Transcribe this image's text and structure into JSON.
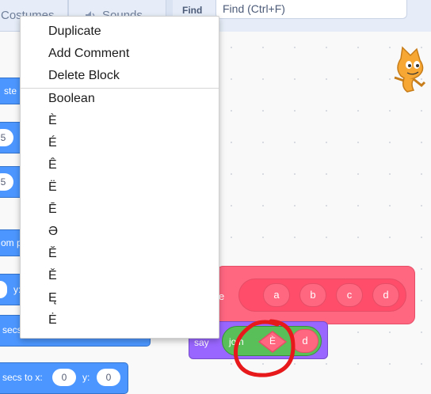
{
  "tabs": {
    "costumes": "Costumes",
    "sounds": "Sounds"
  },
  "find": {
    "label": "Find",
    "placeholder": "Find (Ctrl+F)"
  },
  "palette_blocks": [
    {
      "text": "ste"
    },
    {
      "value": "5"
    },
    {
      "value": "5"
    },
    {
      "text": "om p"
    },
    {
      "label": "y:"
    },
    {
      "text": "secs"
    },
    {
      "text": "secs to x:",
      "x_value": "0",
      "y_label": "y:",
      "y_value": "0"
    }
  ],
  "context_menu": {
    "items": [
      "Duplicate",
      "Add Comment",
      "Delete Block"
    ],
    "suggestions": [
      "Boolean",
      "È",
      "É",
      "Ê",
      "Ë",
      "Ē",
      "Ə",
      "Ĕ",
      "Ě",
      "Ę",
      "Ė"
    ]
  },
  "script": {
    "define_label": "e",
    "args": [
      "a",
      "b",
      "c",
      "d"
    ],
    "say_label": "say",
    "join_label": "join",
    "diamond_value": "È",
    "last_arg": "d"
  },
  "colors": {
    "motion": "#4c97ff",
    "custom": "#ff6680",
    "looks": "#9966ff",
    "operators": "#59c059",
    "annotation": "#e8191a"
  }
}
